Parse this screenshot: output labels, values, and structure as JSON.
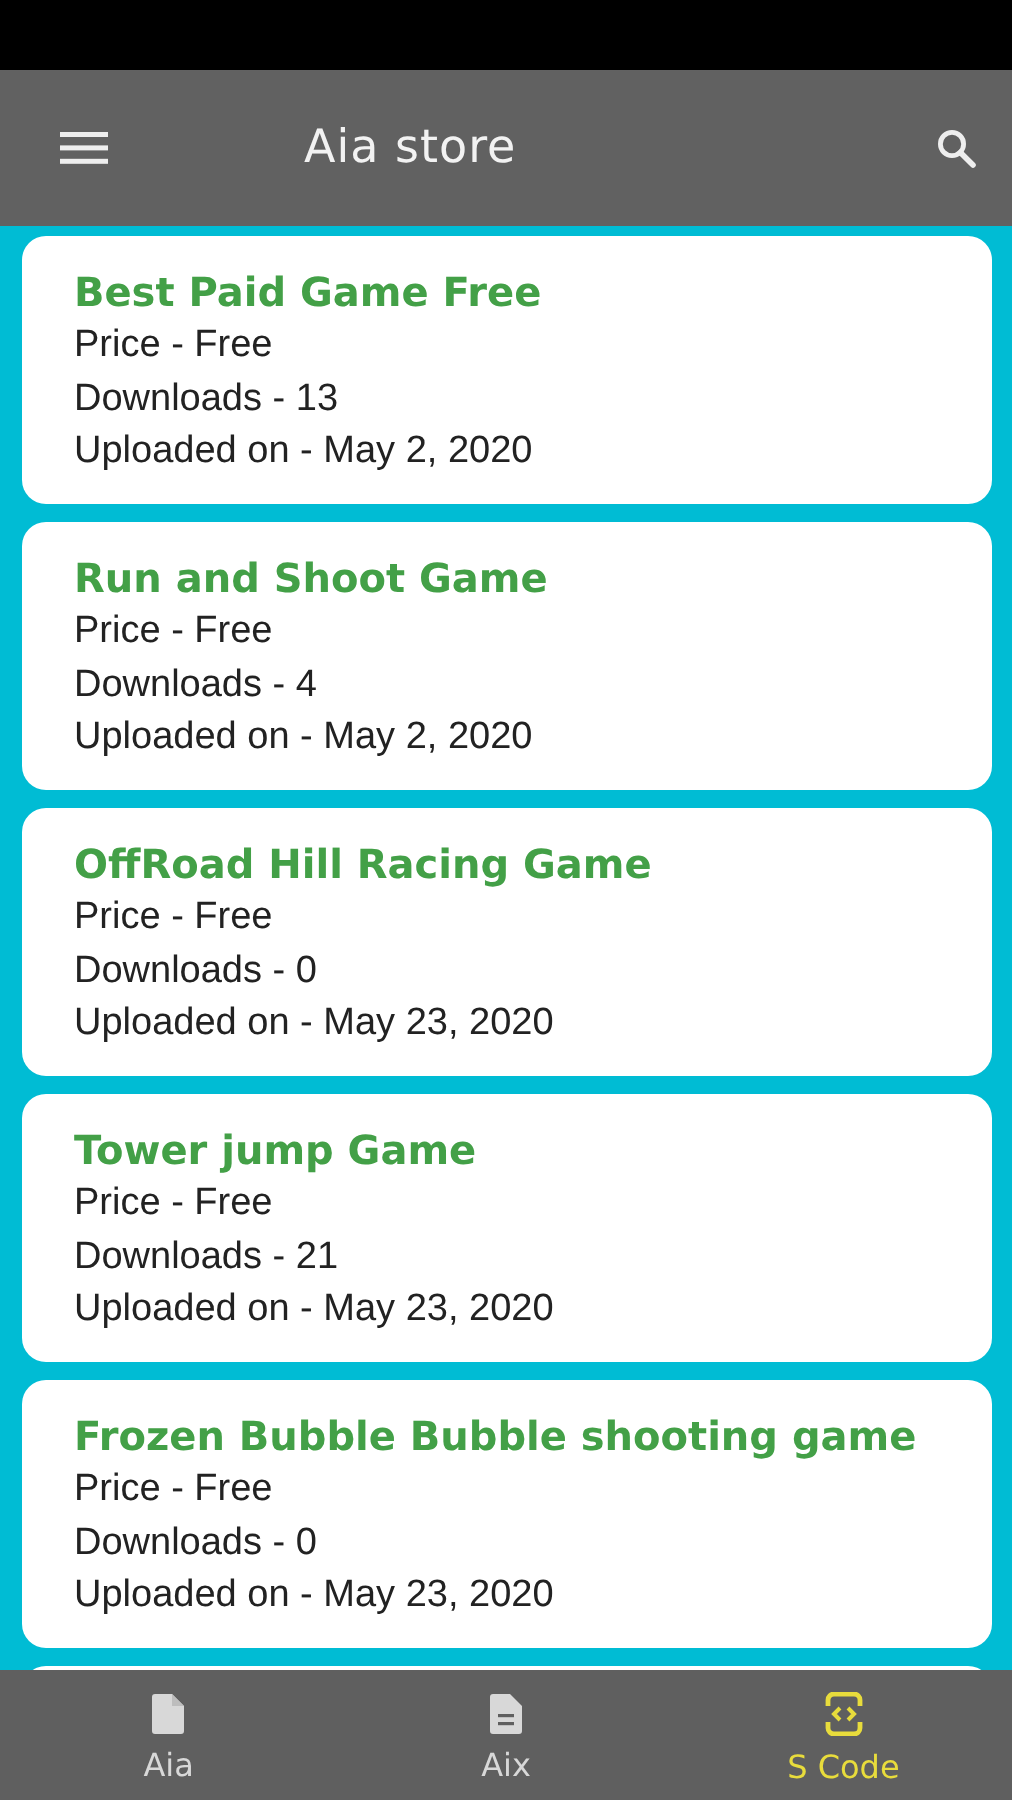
{
  "toolbar": {
    "title": "Aia store"
  },
  "apps": [
    {
      "title": "Best Paid Game Free",
      "price": "Price - Free",
      "downloads": "Downloads - 13",
      "uploaded": "Uploaded on - May 2, 2020"
    },
    {
      "title": "Run and Shoot Game",
      "price": "Price - Free",
      "downloads": "Downloads - 4",
      "uploaded": "Uploaded on - May 2, 2020"
    },
    {
      "title": "OffRoad Hill Racing Game",
      "price": "Price - Free",
      "downloads": "Downloads - 0",
      "uploaded": "Uploaded on - May 23, 2020"
    },
    {
      "title": "Tower jump Game",
      "price": "Price - Free",
      "downloads": "Downloads - 21",
      "uploaded": "Uploaded on - May 23, 2020"
    },
    {
      "title": "Frozen Bubble Bubble shooting game",
      "price": "Price - Free",
      "downloads": "Downloads - 0",
      "uploaded": "Uploaded on - May 23, 2020"
    }
  ],
  "bottom_nav": [
    {
      "label": "Aia",
      "kind": "file",
      "selected": false
    },
    {
      "label": "Aix",
      "kind": "document",
      "selected": false
    },
    {
      "label": "S Code",
      "kind": "code",
      "selected": true
    }
  ]
}
